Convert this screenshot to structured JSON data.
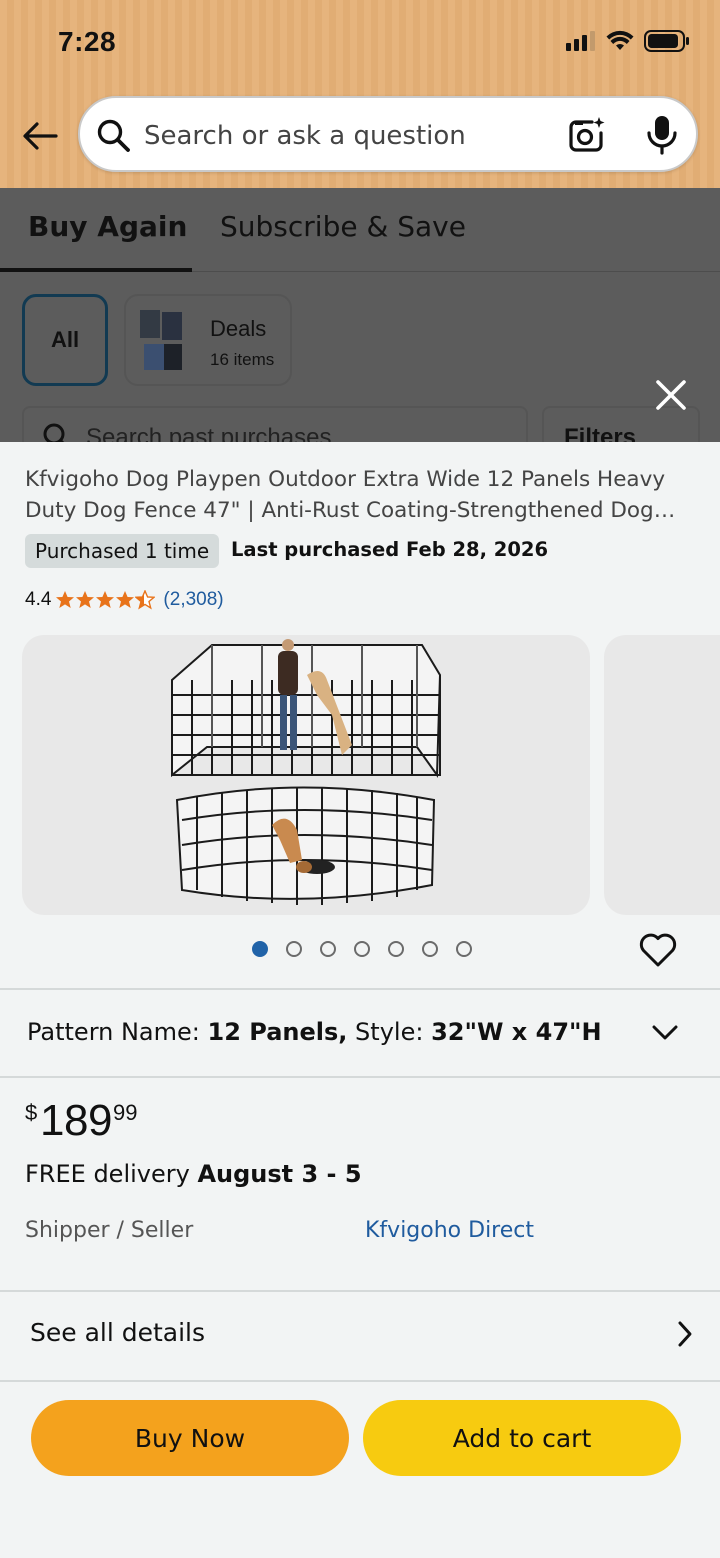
{
  "status_bar": {
    "time": "7:28"
  },
  "search": {
    "placeholder": "Search or ask a question"
  },
  "background": {
    "tabs": [
      {
        "label": "Buy Again",
        "active": true
      },
      {
        "label": "Subscribe & Save",
        "active": false
      }
    ],
    "chips": {
      "all": "All",
      "deals_title": "Deals",
      "deals_count": "16 items"
    },
    "search_placeholder": "Search past purchases",
    "filters_label": "Filters"
  },
  "product": {
    "title": "Kfvigoho Dog Playpen Outdoor Extra Wide 12 Panels Heavy Duty Dog Fence 47\" | Anti-Rust Coating-Strengthened Dog Playpen",
    "purchased_badge": "Purchased 1 time",
    "last_purchased": "Last purchased Feb 28, 2026",
    "rating": {
      "value": "4.4",
      "stars": 4.4,
      "count": "(2,308)"
    },
    "gallery": {
      "image_count": 7,
      "active_index": 0
    },
    "variant": {
      "pattern_label": "Pattern Name:",
      "pattern_value": "12 Panels,",
      "style_label": "Style:",
      "style_value": "32\"W x 47\"H"
    },
    "price": {
      "currency": "$",
      "whole": "189",
      "fraction": "99"
    },
    "delivery": {
      "prefix": "FREE delivery",
      "dates": "August 3 - 5"
    },
    "shipper_label": "Shipper / Seller",
    "shipper_value": "Kfvigoho Direct",
    "see_all_details": "See all details"
  },
  "actions": {
    "buy_now": "Buy Now",
    "add_to_cart": "Add to cart"
  },
  "colors": {
    "header": "#e6b47d",
    "buy_now": "#f4a21d",
    "add_to_cart": "#f7cb10",
    "link": "#1f5b9e",
    "star": "#e8731a",
    "dot_active": "#2163a8"
  }
}
